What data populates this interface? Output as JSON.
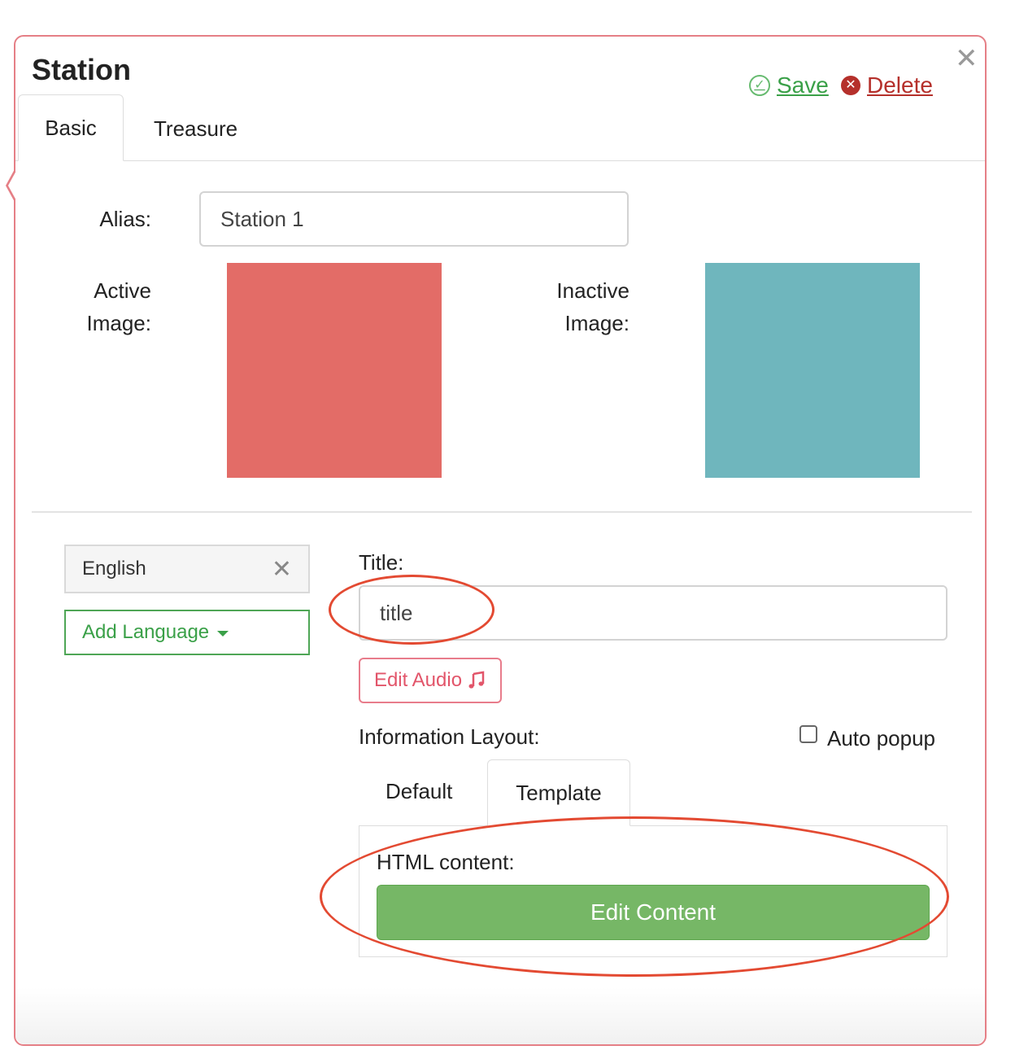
{
  "dialog": {
    "title": "Station",
    "close_icon": "close-icon",
    "save_label": "Save",
    "delete_label": "Delete",
    "tabs": [
      {
        "label": "Basic",
        "active": true
      },
      {
        "label": "Treasure",
        "active": false
      }
    ]
  },
  "basic": {
    "alias_label": "Alias:",
    "alias_value": "Station 1",
    "active_image_label_line1": "Active",
    "active_image_label_line2": "Image:",
    "inactive_image_label_line1": "Inactive",
    "inactive_image_label_line2": "Image:",
    "active_color": "#e36c67",
    "inactive_color": "#6fb6bd"
  },
  "language": {
    "selected": "English",
    "add_label": "Add Language"
  },
  "content": {
    "title_label": "Title:",
    "title_value": "title",
    "edit_audio_label": "Edit Audio",
    "layout_label": "Information Layout:",
    "auto_popup_label": "Auto popup",
    "auto_popup_checked": false,
    "layout_tabs": [
      {
        "label": "Default",
        "active": false
      },
      {
        "label": "Template",
        "active": true
      }
    ],
    "html_content_label": "HTML content:",
    "edit_content_label": "Edit Content"
  },
  "colors": {
    "accent_green": "#76b766",
    "danger_red": "#b5302b",
    "popup_border": "#e57f86",
    "annotation_red": "#e34a32"
  }
}
